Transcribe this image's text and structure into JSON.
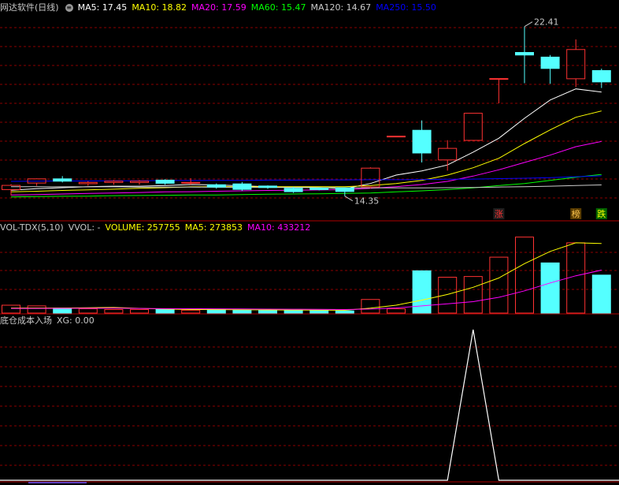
{
  "colors": {
    "bg": "#000000",
    "grid": "#8b0000",
    "up": "#ff3232",
    "down": "#54ffff",
    "ma5": "#ffffff",
    "ma10": "#ffff00",
    "ma20": "#ff00ff",
    "ma60": "#00ff00",
    "ma120": "#cccccc",
    "ma250": "#0000ff",
    "label": "#c8c8c8"
  },
  "price_panel": {
    "title": "网达软件(日线)",
    "menu_icon": "circle-menu-icon",
    "ma_labels": [
      {
        "name": "MA5",
        "value": "17.45",
        "color": "#ffffff"
      },
      {
        "name": "MA10",
        "value": "18.82",
        "color": "#ffff00"
      },
      {
        "name": "MA20",
        "value": "17.59",
        "color": "#ff00ff"
      },
      {
        "name": "MA60",
        "value": "15.47",
        "color": "#00ff00"
      },
      {
        "name": "MA120",
        "value": "14.67",
        "color": "#cccccc"
      },
      {
        "name": "MA250",
        "value": "15.50",
        "color": "#0000ff"
      }
    ],
    "high_label": "22.41",
    "low_label": "14.35",
    "markers": [
      {
        "text": "涨",
        "bar": 19,
        "bg": "#1e1e1e",
        "color": "#ff3232"
      },
      {
        "text": "榜",
        "bar": 22,
        "bg": "#5a3c00",
        "color": "#ffc850"
      },
      {
        "text": "跌",
        "bar": 23,
        "bg": "#006400",
        "color": "#ffff00"
      }
    ]
  },
  "volume_panel": {
    "title": "VOL-TDX(5,10)",
    "labels": [
      {
        "name": "VVOL",
        "value": "-",
        "color": "#c8c8c8"
      },
      {
        "name": "VOLUME",
        "value": "257755",
        "color": "#ffff00"
      },
      {
        "name": "MA5",
        "value": "273853",
        "color": "#ffff00"
      },
      {
        "name": "MA10",
        "value": "433212",
        "color": "#ff00ff"
      }
    ]
  },
  "indicator_panel": {
    "title": "底仓成本入场",
    "labels": [
      {
        "name": "XG",
        "value": "0.00",
        "color": "#c8c8c8"
      }
    ]
  },
  "chart_data": {
    "type": "candlestick",
    "bars": [
      {
        "o": 14.66,
        "h": 14.92,
        "l": 14.38,
        "c": 14.86
      },
      {
        "o": 14.97,
        "h": 15.19,
        "l": 14.84,
        "c": 15.17
      },
      {
        "o": 15.17,
        "h": 15.3,
        "l": 15.0,
        "c": 15.06
      },
      {
        "o": 14.94,
        "h": 15.06,
        "l": 14.84,
        "c": 15.0
      },
      {
        "o": 15.0,
        "h": 15.11,
        "l": 14.89,
        "c": 15.06
      },
      {
        "o": 15.0,
        "h": 15.11,
        "l": 14.89,
        "c": 15.06
      },
      {
        "o": 15.11,
        "h": 15.15,
        "l": 14.89,
        "c": 14.96
      },
      {
        "o": 15.0,
        "h": 15.2,
        "l": 14.89,
        "c": 15.0
      },
      {
        "o": 14.89,
        "h": 14.95,
        "l": 14.7,
        "c": 14.78
      },
      {
        "o": 14.93,
        "h": 15.02,
        "l": 14.6,
        "c": 14.67
      },
      {
        "o": 14.83,
        "h": 14.86,
        "l": 14.7,
        "c": 14.76
      },
      {
        "o": 14.72,
        "h": 14.79,
        "l": 14.5,
        "c": 14.56
      },
      {
        "o": 14.73,
        "h": 14.76,
        "l": 14.62,
        "c": 14.66
      },
      {
        "o": 14.74,
        "h": 14.77,
        "l": 14.35,
        "c": 14.57
      },
      {
        "o": 14.79,
        "h": 15.72,
        "l": 14.71,
        "c": 15.68
      },
      {
        "o": 17.2,
        "h": 17.2,
        "l": 17.2,
        "c": 17.2
      },
      {
        "o": 17.48,
        "h": 17.95,
        "l": 15.95,
        "c": 16.4
      },
      {
        "o": 16.07,
        "h": 17.01,
        "l": 15.56,
        "c": 16.62
      },
      {
        "o": 17.0,
        "h": 18.29,
        "l": 17.0,
        "c": 18.29
      },
      {
        "o": 19.94,
        "h": 19.94,
        "l": 18.76,
        "c": 19.94
      },
      {
        "o": 21.18,
        "h": 22.41,
        "l": 19.72,
        "c": 21.06
      },
      {
        "o": 20.96,
        "h": 21.06,
        "l": 19.69,
        "c": 20.42
      },
      {
        "o": 19.93,
        "h": 21.8,
        "l": 19.54,
        "c": 21.32
      },
      {
        "o": 20.32,
        "h": 20.41,
        "l": 19.49,
        "c": 19.78
      }
    ],
    "ma": {
      "MA5": [
        14.63,
        14.7,
        14.75,
        14.8,
        14.82,
        14.82,
        14.85,
        14.9,
        14.88,
        14.84,
        14.8,
        14.78,
        14.76,
        14.7,
        14.95,
        15.35,
        15.55,
        15.83,
        16.44,
        17.1,
        18.05,
        18.92,
        19.45,
        19.3
      ],
      "MA10": [
        14.55,
        14.58,
        14.62,
        14.65,
        14.68,
        14.72,
        14.75,
        14.79,
        14.8,
        14.8,
        14.8,
        14.8,
        14.8,
        14.8,
        14.85,
        14.95,
        15.1,
        15.35,
        15.7,
        16.15,
        16.85,
        17.5,
        18.1,
        18.4
      ],
      "MA20": [
        14.4,
        14.42,
        14.45,
        14.48,
        14.5,
        14.52,
        14.55,
        14.56,
        14.58,
        14.6,
        14.62,
        14.63,
        14.64,
        14.66,
        14.72,
        14.8,
        14.9,
        15.05,
        15.3,
        15.6,
        15.95,
        16.3,
        16.7,
        16.95
      ],
      "MA60": [
        14.31,
        14.33,
        14.34,
        14.35,
        14.37,
        14.38,
        14.39,
        14.4,
        14.4,
        14.42,
        14.44,
        14.45,
        14.46,
        14.48,
        14.5,
        14.55,
        14.6,
        14.66,
        14.74,
        14.85,
        14.95,
        15.1,
        15.25,
        15.38
      ],
      "MA120": [
        14.8,
        14.8,
        14.79,
        14.79,
        14.79,
        14.78,
        14.78,
        14.78,
        14.77,
        14.77,
        14.76,
        14.76,
        14.75,
        14.75,
        14.74,
        14.74,
        14.74,
        14.75,
        14.76,
        14.78,
        14.8,
        14.82,
        14.85,
        14.88
      ],
      "MA250": [
        15.05,
        15.06,
        15.07,
        15.07,
        15.08,
        15.08,
        15.09,
        15.09,
        15.1,
        15.1,
        15.11,
        15.11,
        15.12,
        15.12,
        15.13,
        15.13,
        15.14,
        15.15,
        15.16,
        15.18,
        15.2,
        15.23,
        15.27,
        15.32
      ]
    },
    "volume": [
      11000,
      10000,
      7000,
      6000,
      5000,
      5000,
      5000,
      4000,
      5000,
      4000,
      4000,
      4000,
      4000,
      3000,
      19000,
      6000,
      59000,
      50000,
      51000,
      78000,
      106000,
      70000,
      98000,
      53000
    ],
    "vol_up": [
      true,
      true,
      false,
      true,
      true,
      true,
      false,
      true,
      false,
      false,
      false,
      false,
      false,
      false,
      true,
      true,
      false,
      true,
      true,
      true,
      true,
      false,
      true,
      false
    ],
    "vol_ma5": [
      7000,
      7000,
      7000,
      7500,
      7800,
      6600,
      5600,
      5000,
      4800,
      4600,
      4400,
      4300,
      4100,
      4000,
      6800,
      11000,
      18000,
      26000,
      36000,
      49000,
      69000,
      86000,
      98000,
      97000
    ],
    "vol_ma10": [
      6500,
      6500,
      6600,
      6700,
      6800,
      6500,
      6200,
      6000,
      5900,
      5700,
      5500,
      5400,
      5200,
      5000,
      5600,
      7200,
      10000,
      13000,
      16000,
      22000,
      31000,
      42000,
      52000,
      60000
    ],
    "xg": [
      0,
      0,
      0,
      0,
      0,
      0,
      0,
      0,
      0,
      0,
      0,
      0,
      0,
      0,
      0,
      0,
      0,
      0,
      1,
      0,
      0,
      0,
      0,
      0
    ]
  }
}
